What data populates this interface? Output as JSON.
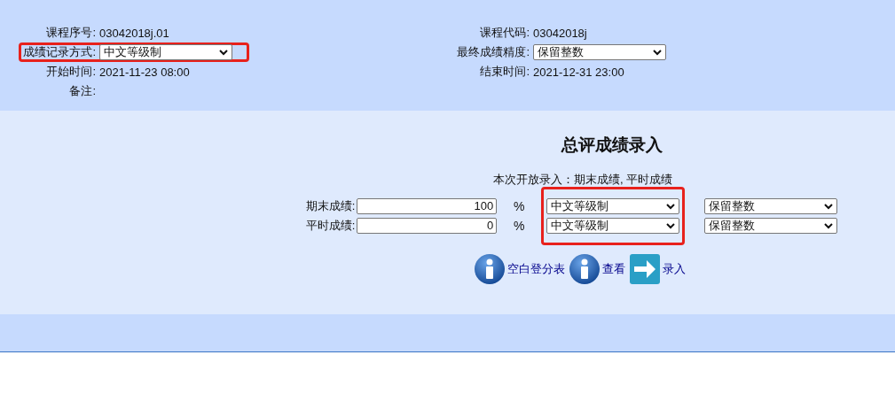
{
  "header": {
    "left": [
      {
        "kind": "text",
        "label": "课程序号:",
        "value": "03042018j.01",
        "highlighted": false
      },
      {
        "kind": "select",
        "label": "成绩记录方式:",
        "value": "中文等级制",
        "highlighted": true
      },
      {
        "kind": "text",
        "label": "开始时间:",
        "value": "2021-11-23 08:00",
        "highlighted": false
      },
      {
        "kind": "text",
        "label": "备注:",
        "highlighted": false
      }
    ],
    "right": [
      {
        "kind": "text",
        "label": "课程代码:",
        "value": "03042018j",
        "highlighted": false
      },
      {
        "kind": "select",
        "label": "最终成绩精度:",
        "value": "保留整数",
        "highlighted": false
      },
      {
        "kind": "text",
        "label": "结束时间:",
        "value": "2021-12-31 23:00",
        "highlighted": false
      }
    ]
  },
  "entry": {
    "title": "总评成绩录入",
    "notice": "本次开放录入：期末成绩, 平时成绩",
    "scale_highlighted": true,
    "rows": [
      {
        "label": "期末成绩:",
        "percent": "100",
        "unit": "%",
        "scale": "中文等级制",
        "precision": "保留整数"
      },
      {
        "label": "平时成绩:",
        "percent": "0",
        "unit": "%",
        "scale": "中文等级制",
        "precision": "保留整数"
      }
    ],
    "actions": [
      {
        "kind": "info",
        "label": "空白登分表"
      },
      {
        "kind": "info",
        "label": "查看"
      },
      {
        "kind": "arrow",
        "label": "录入"
      }
    ]
  }
}
